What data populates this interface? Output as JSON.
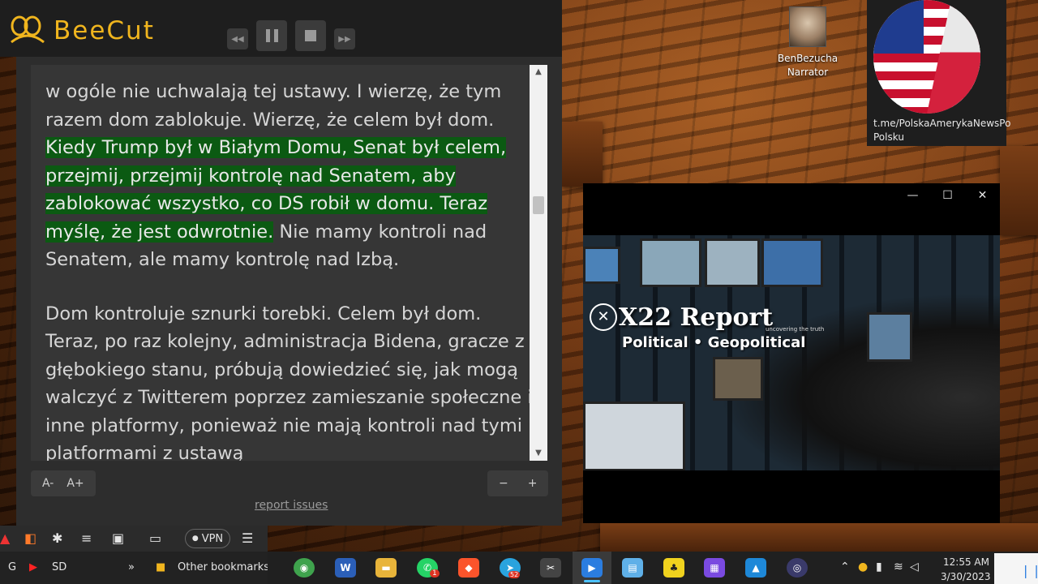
{
  "app": {
    "name": "BeeCut",
    "brand_color": "#f0b51e"
  },
  "reader": {
    "paragraphs": [
      {
        "before": "w ogóle nie uchwalają tej ustawy. I wierzę, że tym razem dom zablokuje. Wierzę, że celem był dom. ",
        "highlight": "Kiedy Trump był w Białym Domu, Senat był celem, przejmij, przejmij kontrolę nad Senatem, aby zablokować wszystko, co DS robił w domu. Teraz myślę, że jest odwrotnie.",
        "after": " Nie mamy kontroli nad Senatem, ale mamy kontrolę nad Izbą."
      },
      {
        "before": "Dom kontroluje sznurki torebki. Celem był dom. Teraz, po raz kolejny, administracja Bidena, gracze z głębokiego stanu, próbują dowiedzieć się, jak mogą walczyć z Twitterem poprzez zamieszanie społeczne i inne platformy, ponieważ nie mają kontroli nad tymi platformami z ustawą",
        "highlight": "",
        "after": ""
      }
    ],
    "highlight_color": "#0b5a12",
    "font_decrease_label": "A-",
    "font_increase_label": "A+",
    "zoom_out_label": "−",
    "zoom_in_label": "+",
    "report_issues_label": "report issues"
  },
  "browser": {
    "vpn_label": "VPN",
    "bookmarks": {
      "g_label": "G",
      "sd_label": "SD",
      "overflow_label": "»",
      "other_bookmarks_label": "Other bookmarks"
    }
  },
  "desktop": {
    "narrator_icon_label": "BenBezucha Narrator",
    "channel_link": "t.me/PolskaAmerykaNewsPo Polsku"
  },
  "video": {
    "title": "X22 Report",
    "tagline": "uncovering the truth",
    "subtitle": "Political • Geopolitical",
    "minimize": "—",
    "maximize": "☐",
    "close": "✕"
  },
  "taskbar": {
    "time": "12:55 AM",
    "date": "3/30/2023",
    "whatsapp_badge": "1",
    "telegram_badge": "52"
  }
}
